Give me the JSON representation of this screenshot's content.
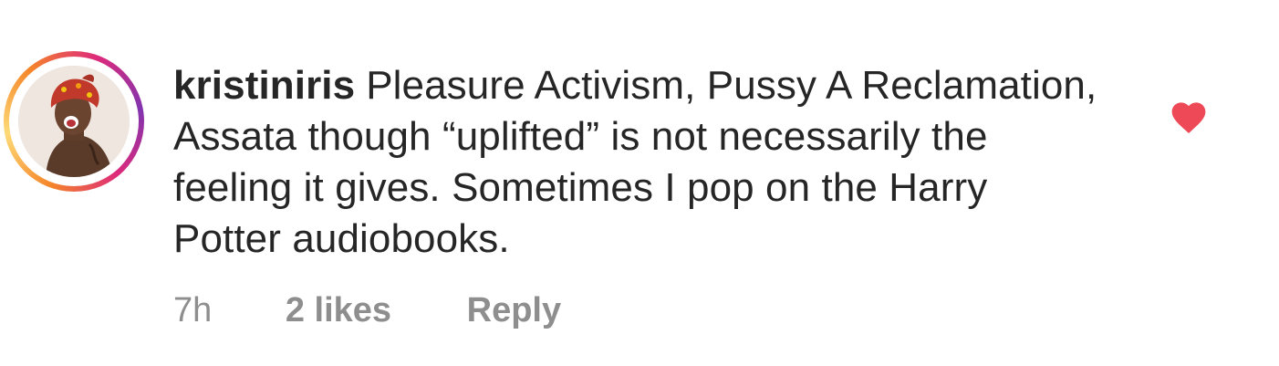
{
  "comment": {
    "username": "kristiniris",
    "text": "Pleasure Activism, Pussy A Reclamation, Assata though “uplifted” is not necessarily the feeling it gives. Sometimes I pop on the Harry Potter audiobooks.",
    "time": "7h",
    "likes": "2 likes",
    "reply_label": "Reply",
    "liked": true
  },
  "icons": {
    "avatar": "avatar",
    "like": "heart-icon"
  },
  "colors": {
    "heart": "#ed4956",
    "username": "#262626",
    "meta": "#8e8e8e"
  }
}
